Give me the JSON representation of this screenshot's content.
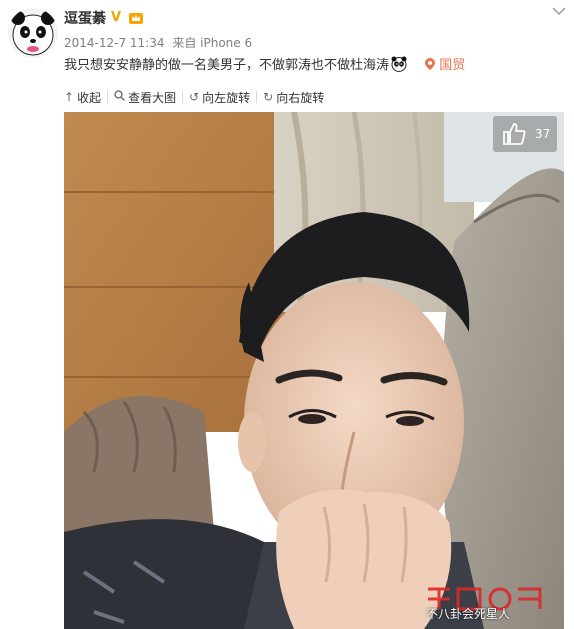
{
  "user": {
    "name": "逗蛋綦",
    "verified_badge": "V"
  },
  "post": {
    "date": "2014-12-7 11:34",
    "source": "来自 iPhone 6",
    "text": "我只想安安静静的做一名美男子，不做郭涛也不做杜海涛",
    "emoji": "panda-face",
    "location": "国贸"
  },
  "toolbar": {
    "collapse": "收起",
    "view_large": "查看大图",
    "rotate_left": "向左旋转",
    "rotate_right": "向右旋转"
  },
  "photo": {
    "likes": "37"
  },
  "watermark": {
    "text": "不八卦会死星人"
  },
  "colors": {
    "location": "#eb7350",
    "meta": "#808080",
    "badge": "#f7a400"
  }
}
